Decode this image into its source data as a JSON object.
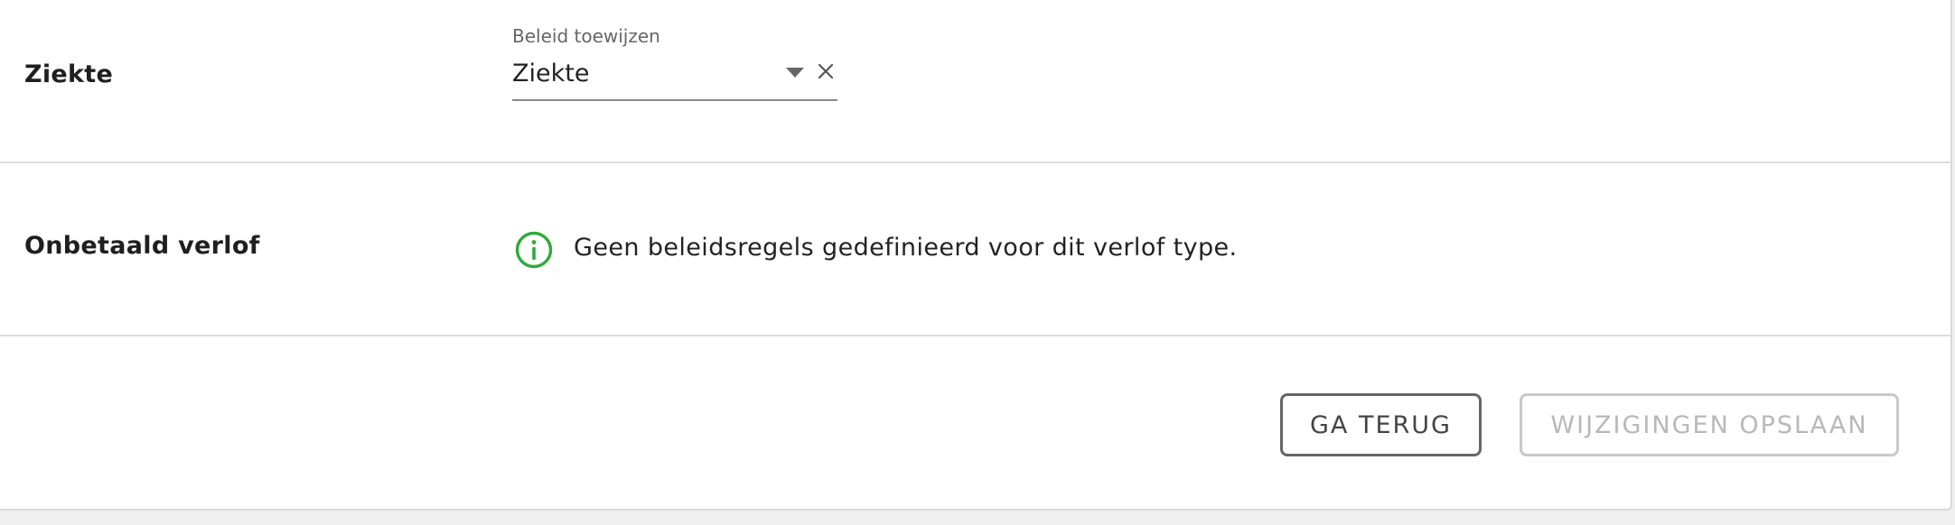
{
  "policies": [
    {
      "label": "Ziekte",
      "select": {
        "label": "Beleid toewijzen",
        "value": "Ziekte"
      }
    },
    {
      "label": "Onbetaald verlof",
      "info": "Geen beleidsregels gedefinieerd voor dit verlof type."
    }
  ],
  "actions": {
    "back_label": "GA TERUG",
    "save_label": "WIJZIGINGEN OPSLAAN",
    "save_disabled": true
  },
  "colors": {
    "info_icon": "#2eaa3c",
    "divider": "#dcdcdc",
    "back_border": "#666666",
    "disabled": "#c8c8c8"
  },
  "icons": {
    "dropdown": "chevron-down-icon",
    "clear": "close-icon",
    "info": "info-circle-icon"
  }
}
